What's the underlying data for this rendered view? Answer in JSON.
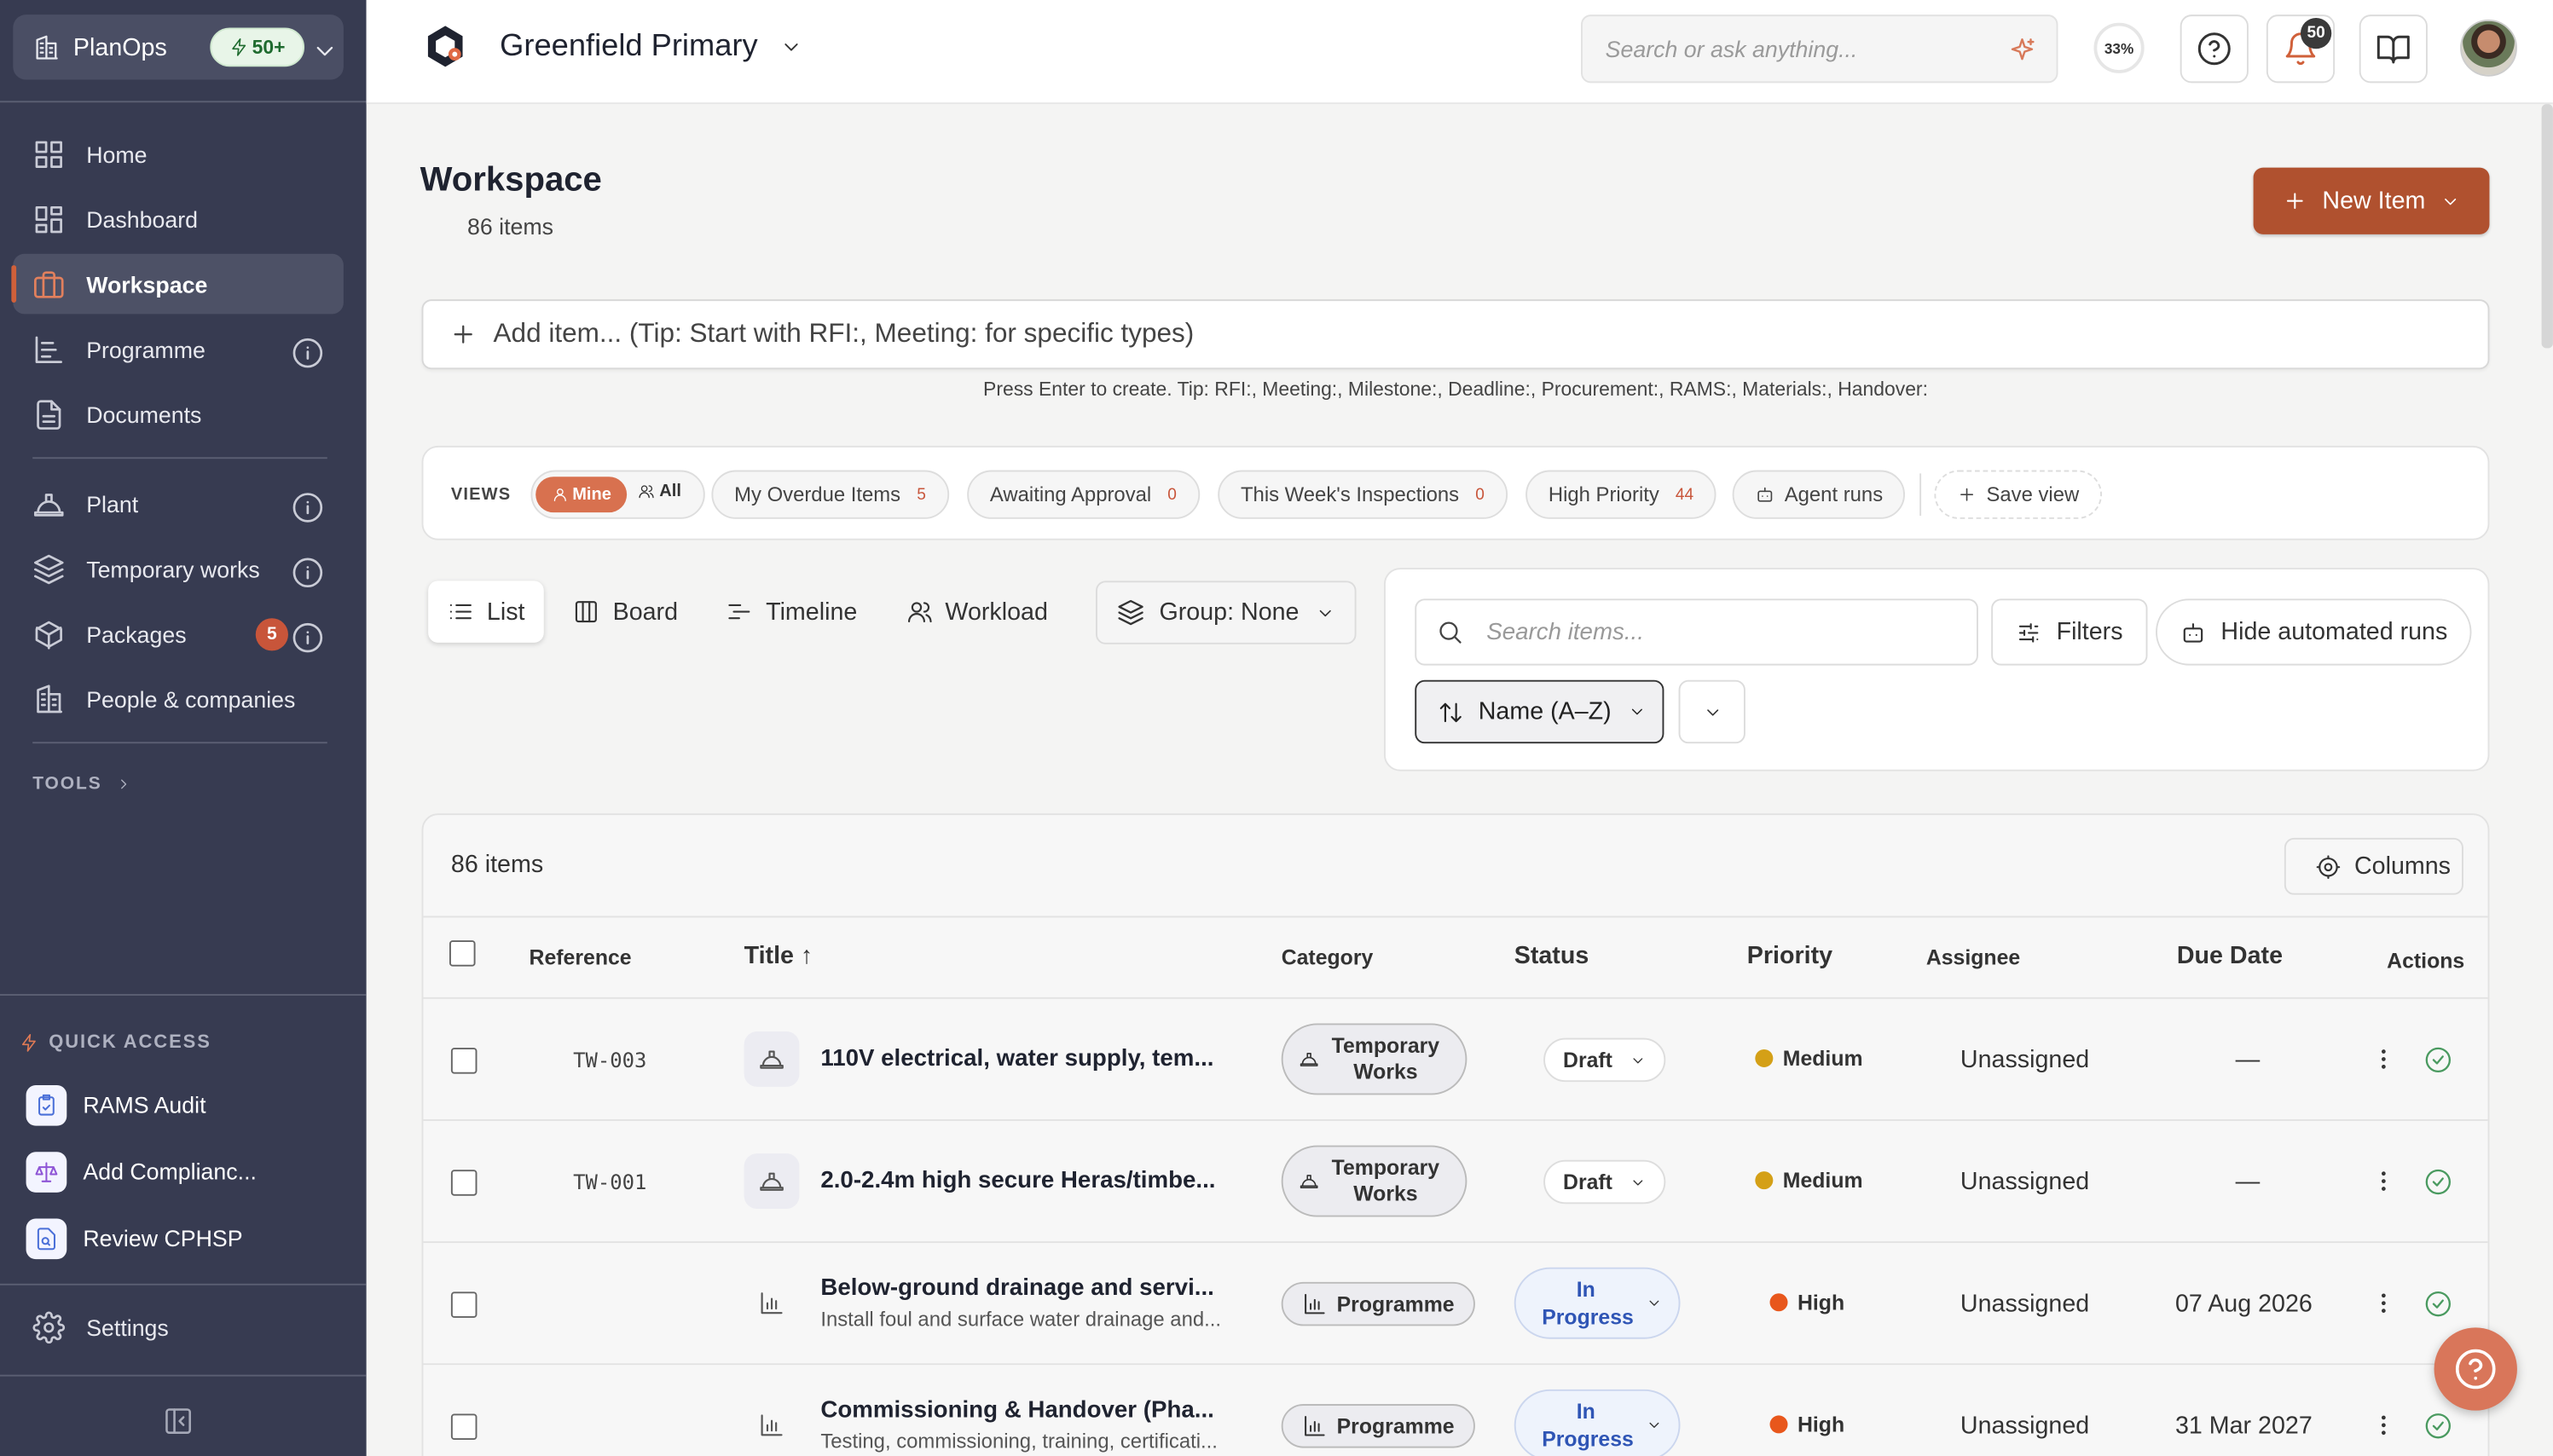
{
  "org": {
    "name": "PlanOps",
    "badge": "50+"
  },
  "sidebar": {
    "items": [
      {
        "label": "Home",
        "icon": "grid-icon"
      },
      {
        "label": "Dashboard",
        "icon": "dashboard-icon"
      },
      {
        "label": "Workspace",
        "icon": "briefcase-icon",
        "active": true
      },
      {
        "label": "Programme",
        "icon": "gantt-icon",
        "info": true
      },
      {
        "label": "Documents",
        "icon": "document-icon"
      },
      {
        "label": "Plant",
        "icon": "hardhat-icon",
        "info": true
      },
      {
        "label": "Temporary works",
        "icon": "layers-icon",
        "info": true
      },
      {
        "label": "Packages",
        "icon": "package-icon",
        "count": "5",
        "info": true
      },
      {
        "label": "People & companies",
        "icon": "building-icon"
      }
    ],
    "tools_label": "TOOLS",
    "quick_access_label": "QUICK ACCESS",
    "quick_access": [
      {
        "label": "RAMS Audit",
        "icon": "clipboard-check-icon"
      },
      {
        "label": "Add Complianc...",
        "icon": "scales-icon"
      },
      {
        "label": "Review CPHSP",
        "icon": "file-search-icon"
      }
    ],
    "settings_label": "Settings"
  },
  "topbar": {
    "project": "Greenfield Primary",
    "search_placeholder": "Search or ask anything...",
    "progress": "33%",
    "notifications": "50"
  },
  "page": {
    "title": "Workspace",
    "count": "86 items",
    "new_item_label": "New Item",
    "add_placeholder": "Add item... (Tip: Start with RFI:, Meeting: for specific types)",
    "add_hint": "Press Enter to create. Tip: RFI:, Meeting:, Milestone:, Deadline:, Procurement:, RAMS:, Materials:, Handover:"
  },
  "views": {
    "label": "VIEWS",
    "mine": "Mine",
    "all": "All",
    "chips": [
      {
        "label": "My Overdue Items",
        "count": "5"
      },
      {
        "label": "Awaiting Approval",
        "count": "0"
      },
      {
        "label": "This Week's Inspections",
        "count": "0"
      },
      {
        "label": "High Priority",
        "count": "44"
      }
    ],
    "agent_runs": "Agent runs",
    "save_view": "Save view"
  },
  "view_tabs": [
    {
      "label": "List",
      "active": true
    },
    {
      "label": "Board"
    },
    {
      "label": "Timeline"
    },
    {
      "label": "Workload"
    }
  ],
  "group_label": "Group: None",
  "filters": {
    "search_placeholder": "Search items...",
    "filters_label": "Filters",
    "hide_runs_label": "Hide automated runs",
    "sort_label": "Name (A–Z)"
  },
  "table": {
    "count": "86 items",
    "columns_label": "Columns",
    "headers": {
      "reference": "Reference",
      "title": "Title ↑",
      "category": "Category",
      "status": "Status",
      "priority": "Priority",
      "assignee": "Assignee",
      "due": "Due Date",
      "actions": "Actions"
    },
    "rows": [
      {
        "ref": "TW-003",
        "title": "110V electrical, water supply, tem...",
        "subtitle": "",
        "category": "Temporary Works",
        "status": "Draft",
        "priority": "Medium",
        "priority_color": "#d4a017",
        "assignee": "Unassigned",
        "due": "—"
      },
      {
        "ref": "TW-001",
        "title": "2.0-2.4m high secure Heras/timbe...",
        "subtitle": "",
        "category": "Temporary Works",
        "status": "Draft",
        "priority": "Medium",
        "priority_color": "#d4a017",
        "assignee": "Unassigned",
        "due": "—"
      },
      {
        "ref": "",
        "title": "Below-ground drainage and servi...",
        "subtitle": "Install foul and surface water drainage and...",
        "category": "Programme",
        "status": "In Progress",
        "priority": "High",
        "priority_color": "#e8571c",
        "assignee": "Unassigned",
        "due": "07 Aug 2026"
      },
      {
        "ref": "",
        "title": "Commissioning & Handover (Pha...",
        "subtitle": "Testing, commissioning, training, certificati...",
        "category": "Programme",
        "status": "In Progress",
        "priority": "High",
        "priority_color": "#e8571c",
        "assignee": "Unassigned",
        "due": "31 Mar 2027"
      }
    ]
  },
  "colors": {
    "sidebar": "#373b51",
    "accent": "#b0512f",
    "active_icon": "#e2805d"
  }
}
